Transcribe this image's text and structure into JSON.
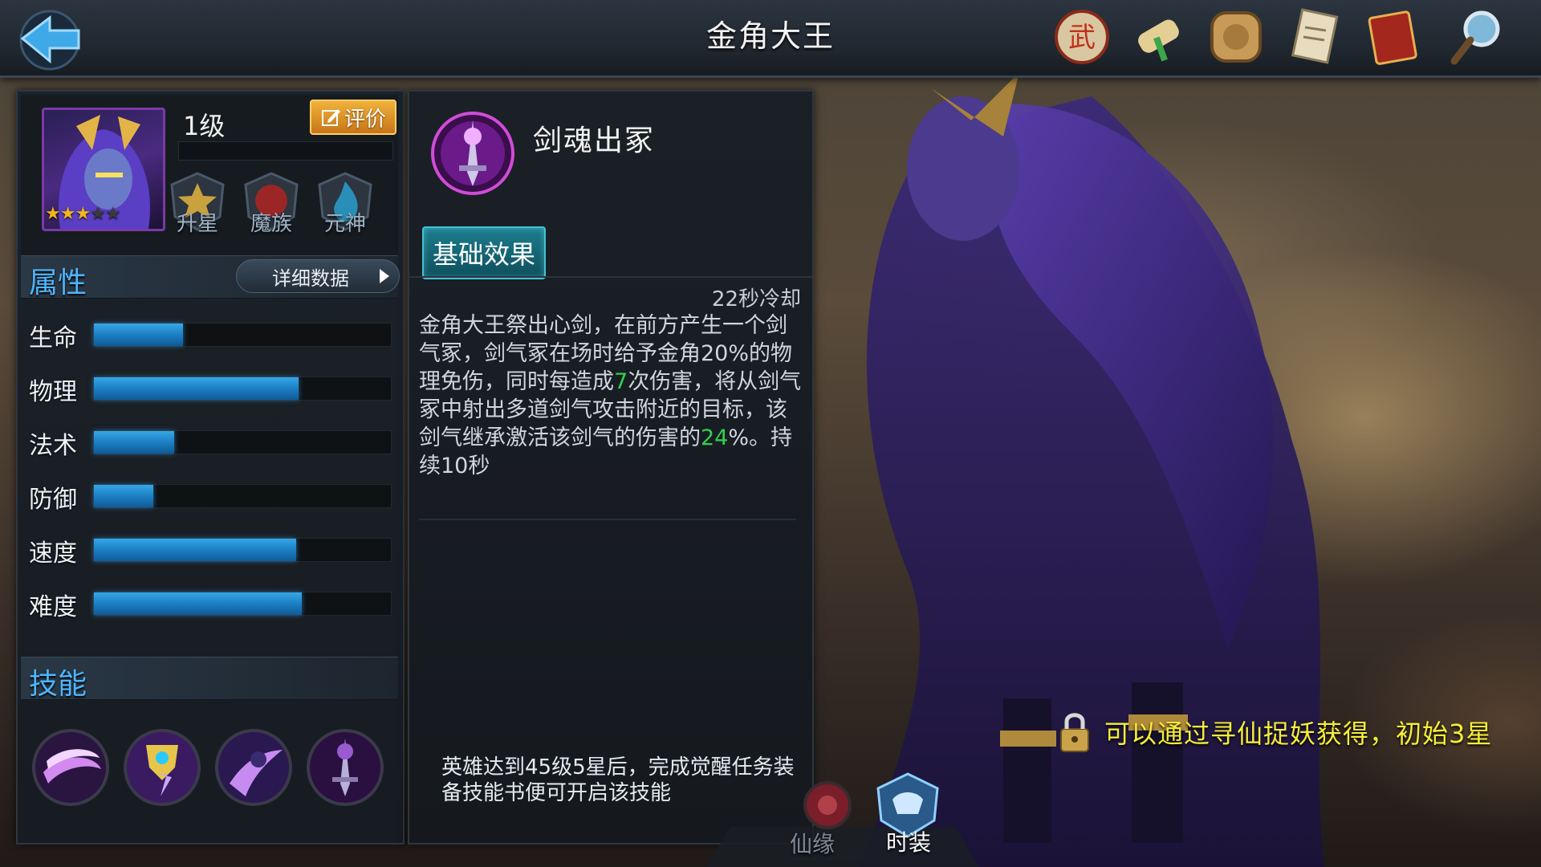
{
  "header": {
    "title": "金角大王",
    "top_icons": [
      "battle-seal-icon",
      "scroll-icon",
      "coin-icon",
      "quest-paper-icon",
      "book-icon",
      "magnifier-icon"
    ]
  },
  "hero": {
    "level": "1级",
    "stars": 3,
    "max_stars": 5,
    "rate_label": "评价",
    "badges": [
      "升星",
      "魔族",
      "元神"
    ]
  },
  "attributes": {
    "title": "属性",
    "detail_label": "详细数据",
    "stats": [
      {
        "label": "生命",
        "value": 0.3
      },
      {
        "label": "物理",
        "value": 0.69
      },
      {
        "label": "法术",
        "value": 0.27
      },
      {
        "label": "防御",
        "value": 0.2
      },
      {
        "label": "速度",
        "value": 0.68
      },
      {
        "label": "难度",
        "value": 0.7
      }
    ]
  },
  "skills": {
    "title": "技能",
    "icons": [
      "swirl-skill-icon",
      "lightning-shield-skill-icon",
      "warrior-strike-skill-icon",
      "sword-tomb-skill-icon"
    ]
  },
  "skill_detail": {
    "name": "剑魂出冢",
    "tab_label": "基础效果",
    "cooldown": "22秒冷却",
    "desc_part1": "金角大王祭出心剑，在前方产生一个剑气冢，剑气冢在场时给予金角20%的物理免伤，同时每造成",
    "desc_hl1": "7",
    "desc_part2": "次伤害，将从剑气冢中射出多道剑气攻击附近的目标，该剑气继承激活该剑气的伤害的",
    "desc_hl2": "24",
    "desc_part3": "%。持续10秒",
    "unlock_note": "英雄达到45级5星后，完成觉醒任务装备技能书便可开启该技能"
  },
  "bottom": {
    "tab_partial_1": "仙缘",
    "tab_costume": "时装"
  },
  "obtain_message": "可以通过寻仙捉妖获得，初始3星",
  "colors": {
    "accent_blue": "#4fb5ff",
    "highlight_green": "#2fd24a",
    "message_yellow": "#f7ee38",
    "rate_orange": "#e89a2c"
  }
}
